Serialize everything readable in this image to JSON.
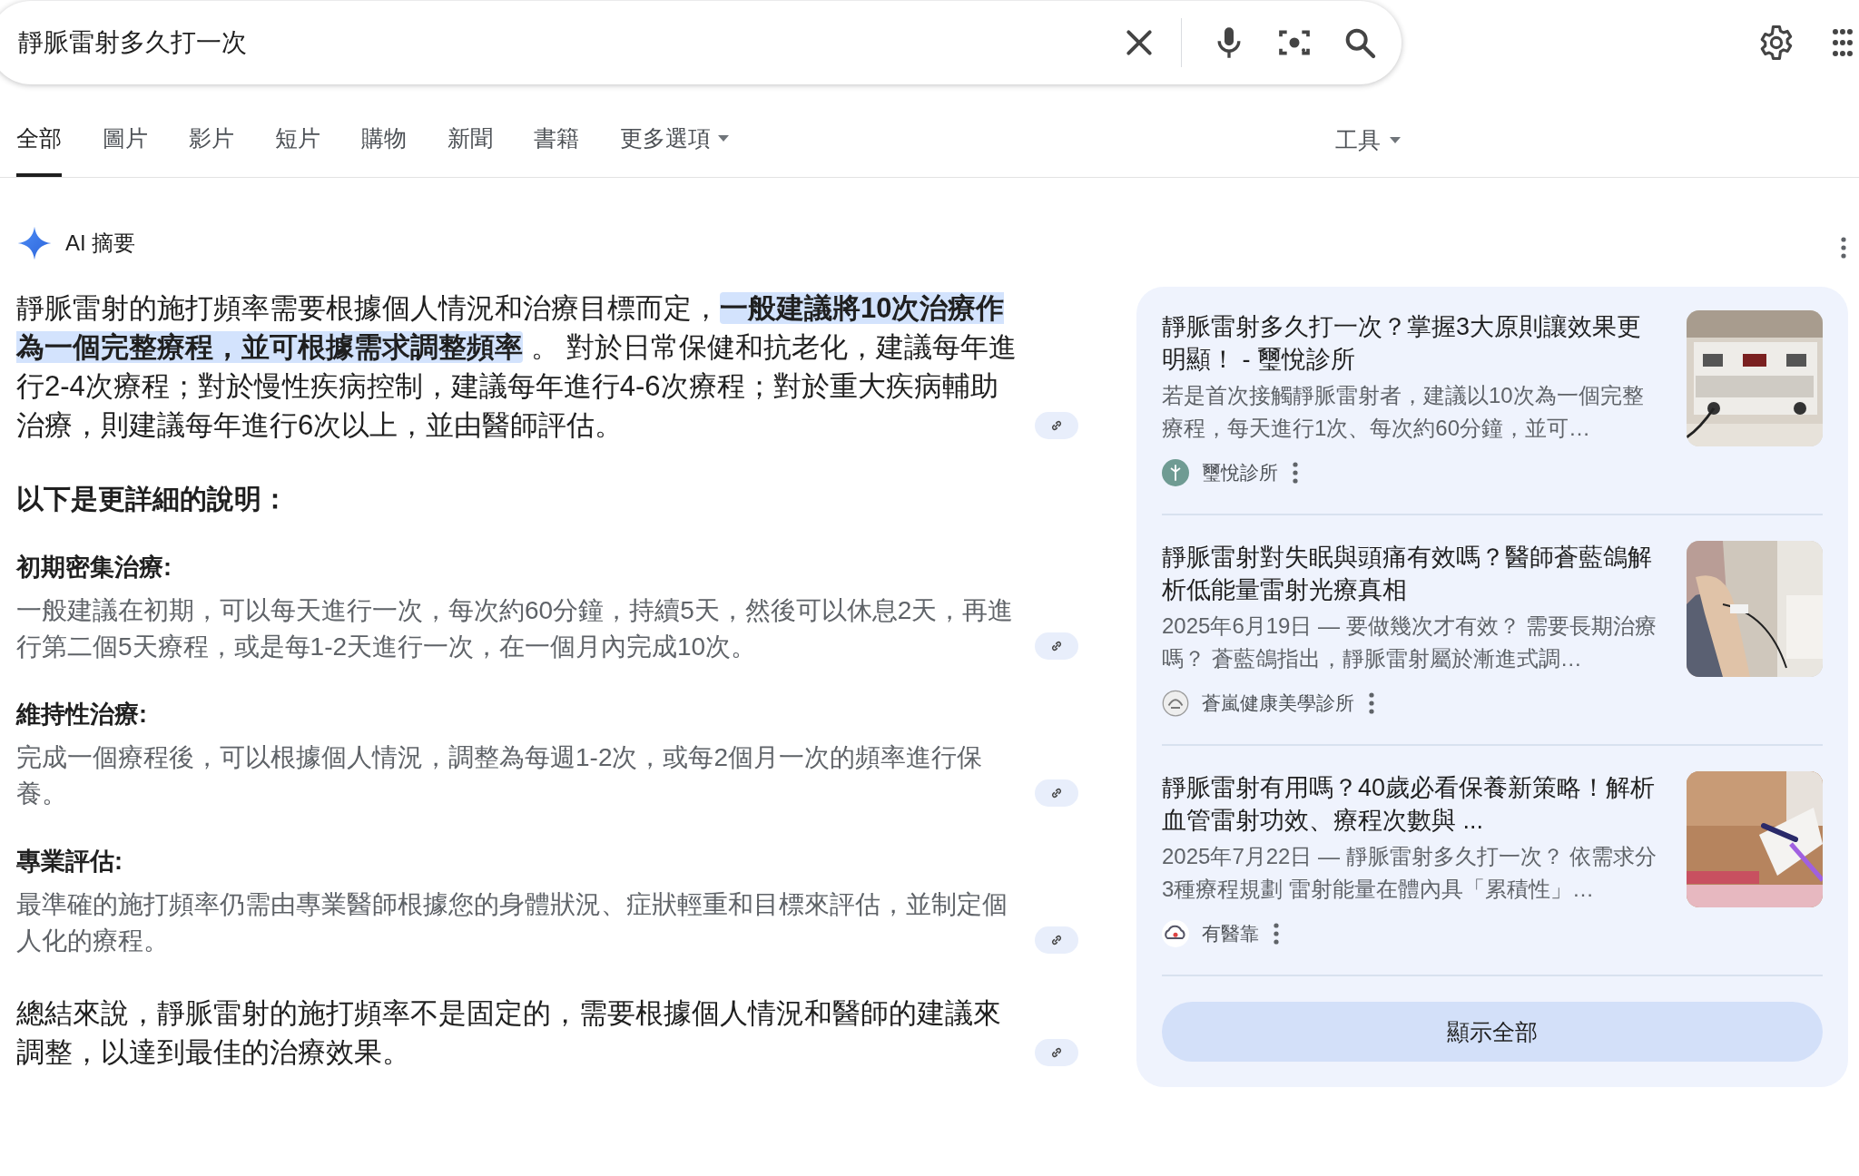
{
  "search": {
    "value": "靜脈雷射多久打一次"
  },
  "tabs": [
    {
      "label": "全部",
      "selected": true,
      "kind": "link"
    },
    {
      "label": "圖片",
      "selected": false,
      "kind": "link"
    },
    {
      "label": "影片",
      "selected": false,
      "kind": "link"
    },
    {
      "label": "短片",
      "selected": false,
      "kind": "link"
    },
    {
      "label": "購物",
      "selected": false,
      "kind": "link"
    },
    {
      "label": "新聞",
      "selected": false,
      "kind": "link"
    },
    {
      "label": "書籍",
      "selected": false,
      "kind": "link"
    },
    {
      "label": "更多選項",
      "selected": false,
      "kind": "menu"
    }
  ],
  "tools": {
    "label": "工具"
  },
  "ai_overview": {
    "label": "AI 摘要",
    "intro": "靜脈雷射的施打頻率需要根據個人情況和治療目標而定，**一般建議將10次治療作為一個完整療程，並可根據需求調整頻率** 。 對於日常保健和抗老化，建議每年進行2-4次療程；對於慢性疾病控制，建議每年進行4-6次療程；對於重大疾病輔助治療，則建議每年進行6次以上，並由醫師評估。",
    "heading": "以下是更詳細的說明：",
    "sections": [
      {
        "title": "初期密集治療:",
        "text": "一般建議在初期，可以每天進行一次，每次約60分鐘，持續5天，然後可以休息2天，再進行第二個5天療程，或是每1-2天進行一次，在一個月內完成10次。"
      },
      {
        "title": "維持性治療:",
        "text": "完成一個療程後，可以根據個人情況，調整為每週1-2次，或每2個月一次的頻率進行保養。"
      },
      {
        "title": "專業評估:",
        "text": "最準確的施打頻率仍需由專業醫師根據您的身體狀況、症狀輕重和目標來評估，並制定個人化的療程。"
      }
    ],
    "conclusion": "總結來說，靜脈雷射的施打頻率不是固定的，需要根據個人情況和醫師的建議來調整，以達到最佳的治療效果。"
  },
  "sources": [
    {
      "title": "靜脈雷射多久打一次？掌握3大原則讓效果更明顯！ - 璽悅診所",
      "snippet": "若是首次接觸靜脈雷射者，建議以10次為一個完整療程，每天進行1次、每次約60分鐘，並可…",
      "site": "璽悅診所",
      "kind": "device"
    },
    {
      "title": "靜脈雷射對失眠與頭痛有效嗎？醫師蒼藍鴿解析低能量雷射光療真相",
      "snippet": "2025年6月19日 — 要做幾次才有效？ 需要長期治療嗎？ 蒼藍鴿指出，靜脈雷射屬於漸進式調…",
      "site": "蒼嵐健康美學診所",
      "kind": "arm"
    },
    {
      "title": "靜脈雷射有用嗎？40歲必看保養新策略！解析血管雷射功效、療程次數與 ...",
      "snippet": "2025年7月22日 — 靜脈雷射多久打一次？ 依需求分3種療程規劃 雷射能量在體內具「累積性」…",
      "site": "有醫靠",
      "kind": "towel"
    }
  ],
  "show_all": "顯示全部"
}
